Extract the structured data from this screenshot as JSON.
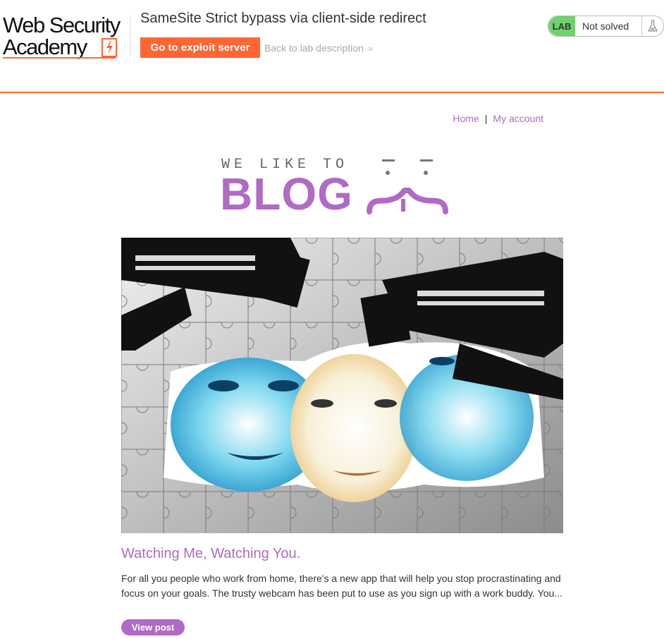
{
  "header": {
    "logo_line1": "Web Security",
    "logo_line2": "Academy",
    "lab_title": "SameSite Strict bypass via client-side redirect",
    "exploit_button": "Go to exploit server",
    "back_link": "Back to lab description",
    "back_chevron": "»",
    "lab_badge": "LAB",
    "lab_status": "Not solved",
    "accent_color": "#ff6633",
    "solved_color": "#70d16d"
  },
  "nav": {
    "home": "Home",
    "separator": "|",
    "my_account": "My account"
  },
  "banner": {
    "top_text": "WE LIKE TO",
    "main_text": "BLOG",
    "accent_color": "#b06bc4"
  },
  "post": {
    "title": "Watching Me, Watching You.",
    "excerpt": "For all you people who work from home, there's a new app that will help you stop procrastinating and focus on your goals. The trusty webcam has been put to use as you sign up with a work buddy. You...",
    "button": "View post"
  }
}
